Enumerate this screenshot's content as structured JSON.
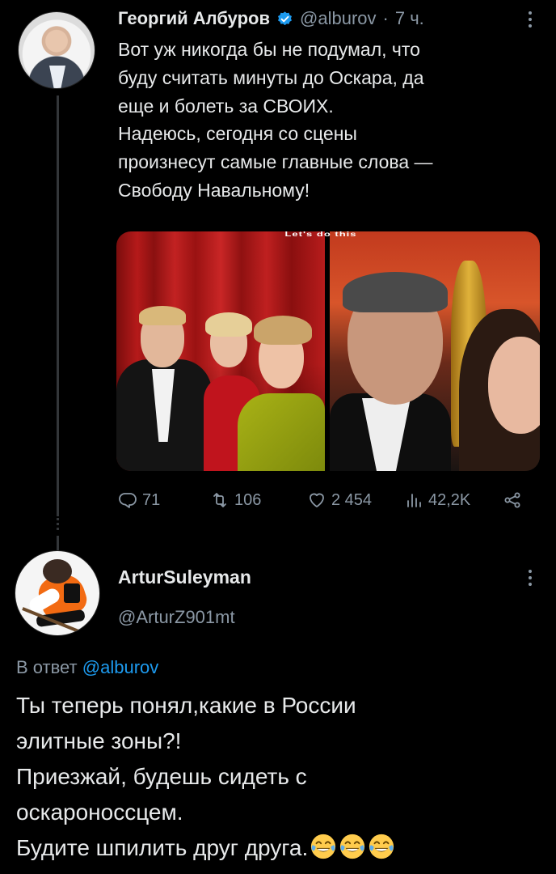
{
  "tweet": {
    "author_name": "Георгий Албуров",
    "handle": "@alburov",
    "separator": "·",
    "time": "7 ч.",
    "lines": [
      "Вот уж никогда бы не подумал, что",
      "буду считать минуты до Оскара, да",
      "еще и болеть за СВОИХ.",
      "Надеюсь, сегодня со сцены",
      "произнесут самые главные слова —",
      "Свободу Навальному!"
    ],
    "media_caption": "Let's do this",
    "stats": {
      "replies": "71",
      "retweets": "106",
      "likes": "2 454",
      "views": "42,2K"
    }
  },
  "reply": {
    "author_name": "ArturSuleyman",
    "handle": "@ArturZ901mt",
    "reply_prefix": "В ответ",
    "reply_mention": "@alburov",
    "lines": [
      "Ты теперь понял,какие в России",
      "элитные зоны?!",
      "Приезжай, будешь сидеть с",
      "оскароноссцем.",
      "Будите шпилить друг друга."
    ],
    "emoji_count": 3,
    "emoji": "face-with-tears-of-joy"
  },
  "colors": {
    "background": "#000000",
    "text": "#e7e9ea",
    "secondary": "#8b98a5",
    "accent": "#1d9bf0"
  },
  "icons": [
    "verified-badge-icon",
    "more-icon",
    "reply-icon",
    "retweet-icon",
    "like-icon",
    "views-icon",
    "share-icon"
  ]
}
